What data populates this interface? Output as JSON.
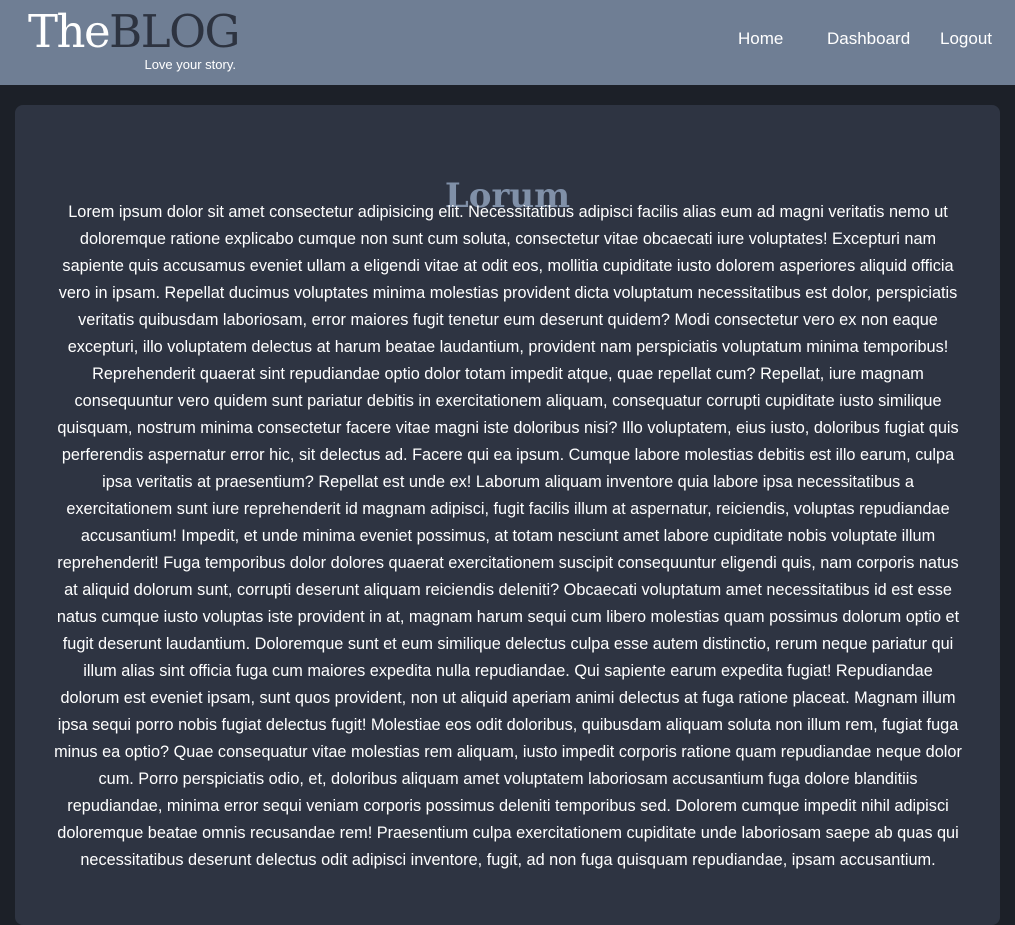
{
  "brand": {
    "the": "The",
    "blog": "BLOG",
    "tagline": "Love your story."
  },
  "nav": {
    "home": "Home",
    "dashboard": "Dashboard",
    "logout": "Logout"
  },
  "post": {
    "title": "Lorum",
    "body": "Lorem ipsum dolor sit amet consectetur adipisicing elit. Necessitatibus adipisci facilis alias eum ad magni veritatis nemo ut doloremque ratione explicabo cumque non sunt cum soluta, consectetur vitae obcaecati iure voluptates! Excepturi nam sapiente quis accusamus eveniet ullam a eligendi vitae at odit eos, mollitia cupiditate iusto dolorem asperiores aliquid officia vero in ipsam. Repellat ducimus voluptates minima molestias provident dicta voluptatum necessitatibus est dolor, perspiciatis veritatis quibusdam laboriosam, error maiores fugit tenetur eum deserunt quidem? Modi consectetur vero ex non eaque excepturi, illo voluptatem delectus at harum beatae laudantium, provident nam perspiciatis voluptatum minima temporibus! Reprehenderit quaerat sint repudiandae optio dolor totam impedit atque, quae repellat cum? Repellat, iure magnam consequuntur vero quidem sunt pariatur debitis in exercitationem aliquam, consequatur corrupti cupiditate iusto similique quisquam, nostrum minima consectetur facere vitae magni iste doloribus nisi? Illo voluptatem, eius iusto, doloribus fugiat quis perferendis aspernatur error hic, sit delectus ad. Facere qui ea ipsum. Cumque labore molestias debitis est illo earum, culpa ipsa veritatis at praesentium? Repellat est unde ex! Laborum aliquam inventore quia labore ipsa necessitatibus a exercitationem sunt iure reprehenderit id magnam adipisci, fugit facilis illum at aspernatur, reiciendis, voluptas repudiandae accusantium! Impedit, et unde minima eveniet possimus, at totam nesciunt amet labore cupiditate nobis voluptate illum reprehenderit! Fuga temporibus dolor dolores quaerat exercitationem suscipit consequuntur eligendi quis, nam corporis natus at aliquid dolorum sunt, corrupti deserunt aliquam reiciendis deleniti? Obcaecati voluptatum amet necessitatibus id est esse natus cumque iusto voluptas iste provident in at, magnam harum sequi cum libero molestias quam possimus dolorum optio et fugit deserunt laudantium. Doloremque sunt et eum similique delectus culpa esse autem distinctio, rerum neque pariatur qui illum alias sint officia fuga cum maiores expedita nulla repudiandae. Qui sapiente earum expedita fugiat! Repudiandae dolorum est eveniet ipsam, sunt quos provident, non ut aliquid aperiam animi delectus at fuga ratione placeat. Magnam illum ipsa sequi porro nobis fugiat delectus fugit! Molestiae eos odit doloribus, quibusdam aliquam soluta non illum rem, fugiat fuga minus ea optio? Quae consequatur vitae molestias rem aliquam, iusto impedit corporis ratione quam repudiandae neque dolor cum. Porro perspiciatis odio, et, doloribus aliquam amet voluptatem laboriosam accusantium fuga dolore blanditiis repudiandae, minima error sequi veniam corporis possimus deleniti temporibus sed. Dolorem cumque impedit nihil adipisci doloremque beatae omnis recusandae rem! Praesentium culpa exercitationem cupiditate unde laboriosam saepe ab quas qui necessitatibus deserunt delectus odit adipisci inventore, fugit, ad non fuga quisquam repudiandae, ipsam accusantium."
  },
  "colors": {
    "header_bg": "#6f7e94",
    "page_bg": "#1c2028",
    "card_bg": "#2e3442",
    "title": "#8090a8",
    "logo_dark": "#2d3340"
  }
}
